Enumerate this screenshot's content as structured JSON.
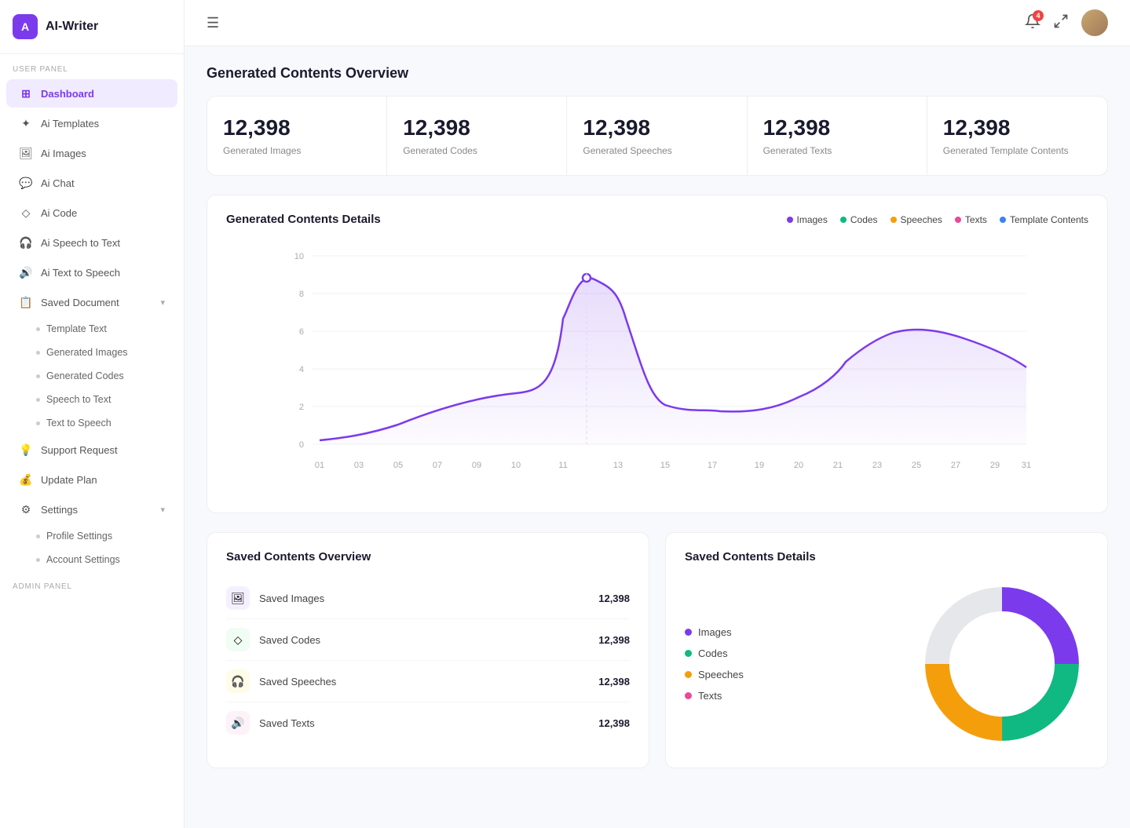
{
  "app": {
    "logo_icon": "A",
    "logo_text": "AI-Writer"
  },
  "sidebar": {
    "section_label": "User Panel",
    "items": [
      {
        "id": "dashboard",
        "label": "Dashboard",
        "icon": "⊞",
        "active": true
      },
      {
        "id": "ai-templates",
        "label": "Ai Templates",
        "icon": "✦"
      },
      {
        "id": "ai-images",
        "label": "Ai Images",
        "icon": "🖼"
      },
      {
        "id": "ai-chat",
        "label": "Ai Chat",
        "icon": "💬"
      },
      {
        "id": "ai-code",
        "label": "Ai Code",
        "icon": "◇"
      },
      {
        "id": "ai-speech-to-text",
        "label": "Ai Speech to Text",
        "icon": "🎧"
      },
      {
        "id": "ai-text-to-speech",
        "label": "Ai Text to Speech",
        "icon": "🔊"
      },
      {
        "id": "saved-document",
        "label": "Saved Document",
        "icon": "📋",
        "hasChevron": true,
        "expanded": true
      }
    ],
    "sub_items": [
      {
        "id": "template-text",
        "label": "Template Text"
      },
      {
        "id": "generated-images",
        "label": "Generated Images"
      },
      {
        "id": "generated-codes",
        "label": "Generated Codes"
      },
      {
        "id": "speech-to-text",
        "label": "Speech to Text"
      },
      {
        "id": "text-to-speech",
        "label": "Text to Speech"
      }
    ],
    "bottom_items": [
      {
        "id": "support-request",
        "label": "Support Request",
        "icon": "💡"
      },
      {
        "id": "update-plan",
        "label": "Update Plan",
        "icon": "💰"
      },
      {
        "id": "settings",
        "label": "Settings",
        "icon": "⚙",
        "hasChevron": true
      },
      {
        "id": "profile-settings",
        "label": "Profile Settings",
        "sub": true
      },
      {
        "id": "account-settings",
        "label": "Account Settings",
        "sub": true
      }
    ],
    "footer_label": "Admin Panel"
  },
  "topbar": {
    "menu_icon": "☰",
    "notif_count": "4",
    "fullscreen_icon": "⤢"
  },
  "page": {
    "generated_overview_title": "Generated Contents Overview",
    "chart_title": "Generated Contents Details",
    "saved_overview_title": "Saved Contents Overview",
    "saved_details_title": "Saved Contents Details"
  },
  "stats": [
    {
      "value": "12,398",
      "label": "Generated Images"
    },
    {
      "value": "12,398",
      "label": "Generated Codes"
    },
    {
      "value": "12,398",
      "label": "Generated Speeches"
    },
    {
      "value": "12,398",
      "label": "Generated Texts"
    },
    {
      "value": "12,398",
      "label": "Generated Template Contents"
    }
  ],
  "chart": {
    "legend": [
      {
        "label": "Images",
        "color": "#7c3aed"
      },
      {
        "label": "Codes",
        "color": "#10b981"
      },
      {
        "label": "Speeches",
        "color": "#f59e0b"
      },
      {
        "label": "Texts",
        "color": "#ec4899"
      },
      {
        "label": "Template Contents",
        "color": "#3b82f6"
      }
    ],
    "y_labels": [
      "10",
      "8",
      "6",
      "4",
      "2",
      "0"
    ],
    "x_labels": [
      "01",
      "03",
      "05",
      "07",
      "09",
      "10",
      "11",
      "13",
      "15",
      "17",
      "19",
      "20",
      "21",
      "23",
      "25",
      "27",
      "29",
      "31"
    ]
  },
  "saved_contents": [
    {
      "label": "Saved Images",
      "value": "12,398",
      "icon": "🖼",
      "color": "#f5f0ff"
    },
    {
      "label": "Saved Codes",
      "value": "12,398",
      "icon": "◇",
      "color": "#f0fdf4"
    },
    {
      "label": "Saved Speeches",
      "value": "12,398",
      "icon": "🎧",
      "color": "#fefce8"
    },
    {
      "label": "Saved Texts",
      "value": "12,398",
      "icon": "🔊",
      "color": "#fdf2f8"
    }
  ],
  "donut_legend": [
    {
      "label": "Images",
      "color": "#7c3aed"
    },
    {
      "label": "Codes",
      "color": "#10b981"
    },
    {
      "label": "Speeches",
      "color": "#f59e0b"
    },
    {
      "label": "Texts",
      "color": "#ec4899"
    }
  ]
}
